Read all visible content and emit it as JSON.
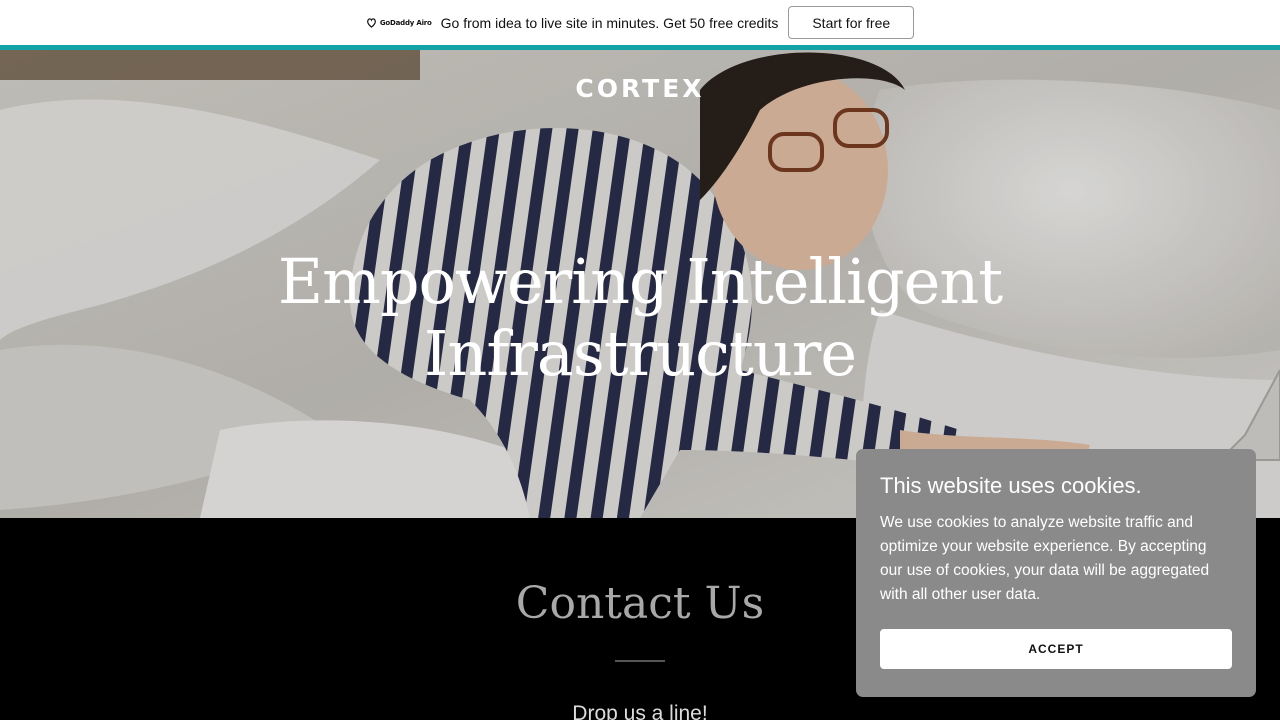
{
  "promo": {
    "logo_text": "GoDaddy Airo",
    "message": "Go from idea to live site in minutes. Get 50 free credits",
    "cta_label": "Start for free"
  },
  "hero": {
    "brand": "CORTEX",
    "headline": "Empowering Intelligent Infrastructure"
  },
  "contact": {
    "title": "Contact Us",
    "subtitle": "Drop us a line!"
  },
  "cookie_banner": {
    "title": "This website uses cookies.",
    "body": "We use cookies to analyze website traffic and optimize your website experience. By accepting our use of cookies, your data will be aggregated with all other user data.",
    "accept_label": "ACCEPT"
  },
  "colors": {
    "promo_accent": "#13a2a5",
    "cookie_bg": "#8a8a8a"
  }
}
